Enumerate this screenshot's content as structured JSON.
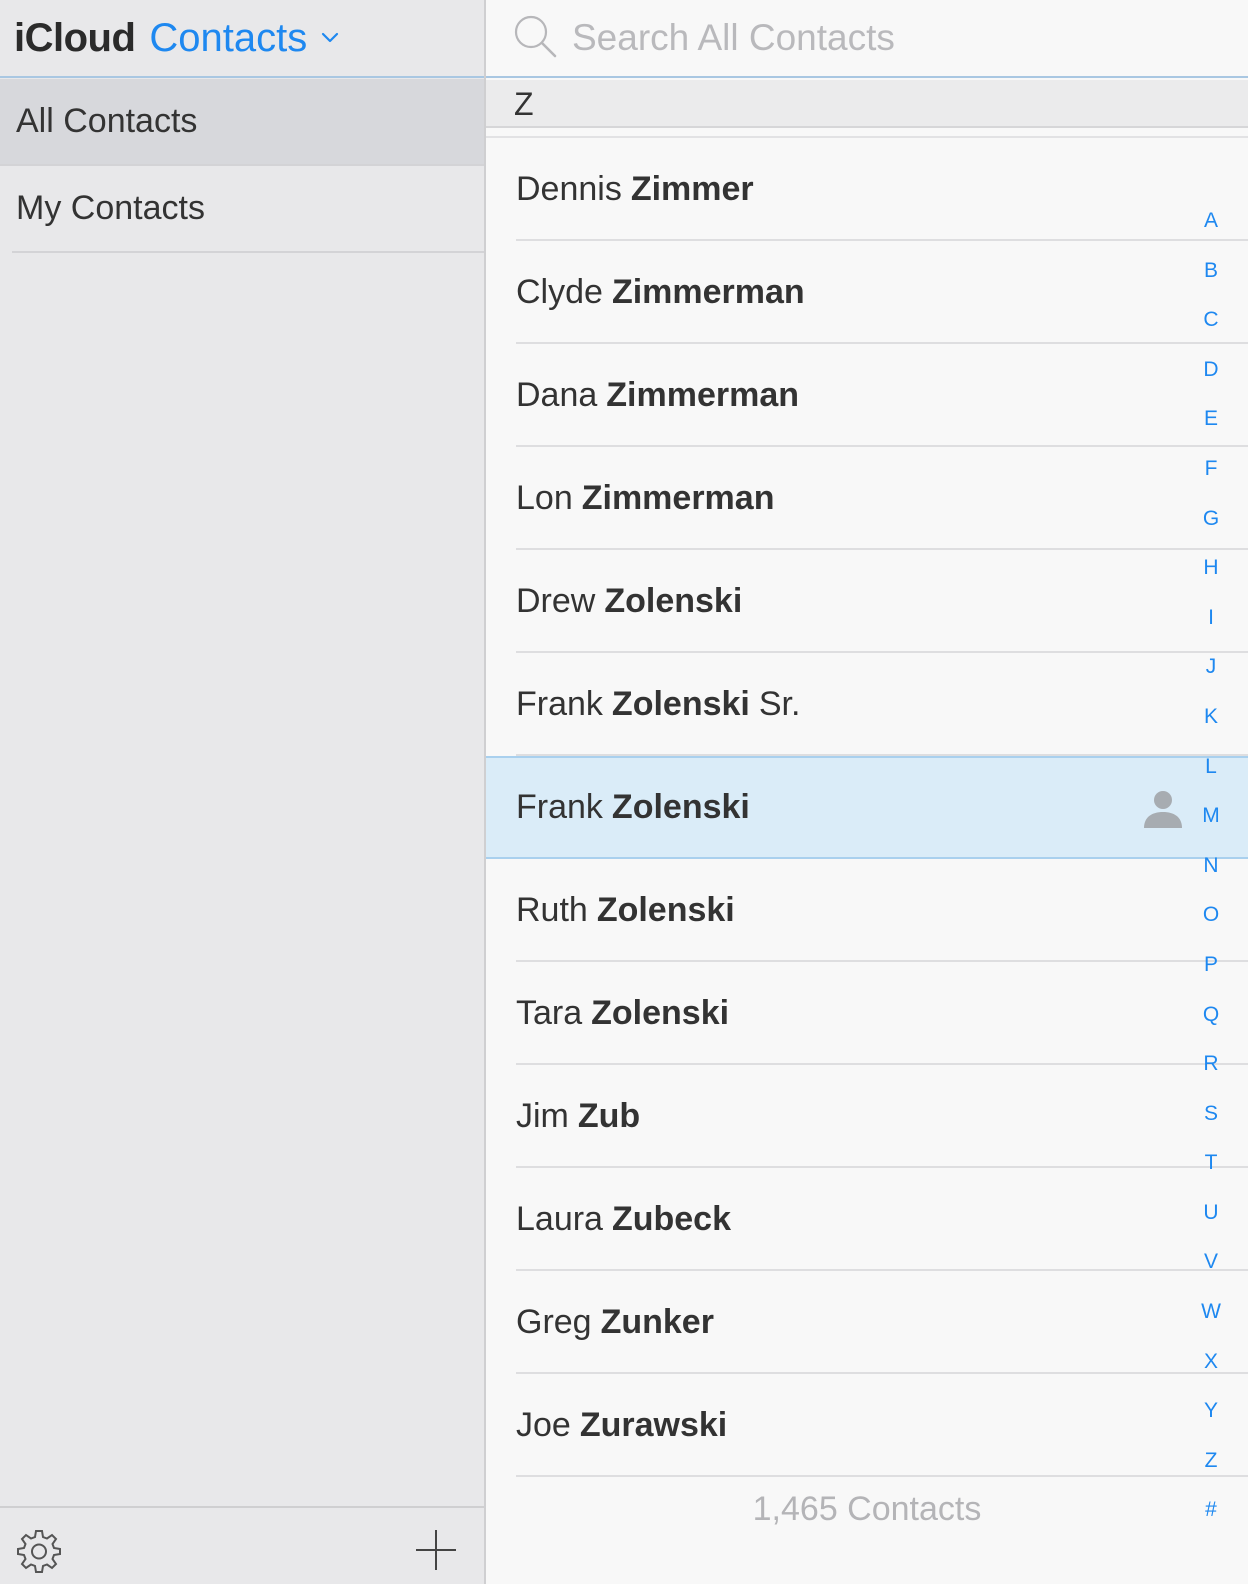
{
  "header": {
    "brand": "iCloud",
    "app_name": "Contacts"
  },
  "groups": [
    {
      "label": "All Contacts",
      "selected": true
    },
    {
      "label": "My Contacts",
      "selected": false
    }
  ],
  "search": {
    "placeholder": "Search All Contacts"
  },
  "section_letter": "Z",
  "contacts": [
    {
      "first": "Dennis",
      "last": "Zimmer",
      "suffix": ""
    },
    {
      "first": "Clyde",
      "last": "Zimmerman",
      "suffix": ""
    },
    {
      "first": "Dana",
      "last": "Zimmerman",
      "suffix": ""
    },
    {
      "first": "Lon",
      "last": "Zimmerman",
      "suffix": ""
    },
    {
      "first": "Drew",
      "last": "Zolenski",
      "suffix": ""
    },
    {
      "first": "Frank",
      "last": "Zolenski",
      "suffix": "Sr."
    },
    {
      "first": "Frank",
      "last": "Zolenski",
      "suffix": "",
      "selected": true
    },
    {
      "first": "Ruth",
      "last": "Zolenski",
      "suffix": ""
    },
    {
      "first": "Tara",
      "last": "Zolenski",
      "suffix": ""
    },
    {
      "first": "Jim",
      "last": "Zub",
      "suffix": ""
    },
    {
      "first": "Laura",
      "last": "Zubeck",
      "suffix": ""
    },
    {
      "first": "Greg",
      "last": "Zunker",
      "suffix": ""
    },
    {
      "first": "Joe",
      "last": "Zurawski",
      "suffix": ""
    }
  ],
  "index_letters": [
    "A",
    "B",
    "C",
    "D",
    "E",
    "F",
    "G",
    "H",
    "I",
    "J",
    "K",
    "L",
    "M",
    "N",
    "O",
    "P",
    "Q",
    "R",
    "S",
    "T",
    "U",
    "V",
    "W",
    "X",
    "Y",
    "Z",
    "#"
  ],
  "contact_count": "1,465 Contacts",
  "colors": {
    "accent": "#1e88f0",
    "selected_row": "#daecf8",
    "sidebar_bg": "#e8e8ea"
  },
  "icons": {
    "settings": "gear-icon",
    "add": "plus-icon",
    "search": "search-icon",
    "menu": "chevron-down-icon",
    "contact_card": "person-icon"
  }
}
